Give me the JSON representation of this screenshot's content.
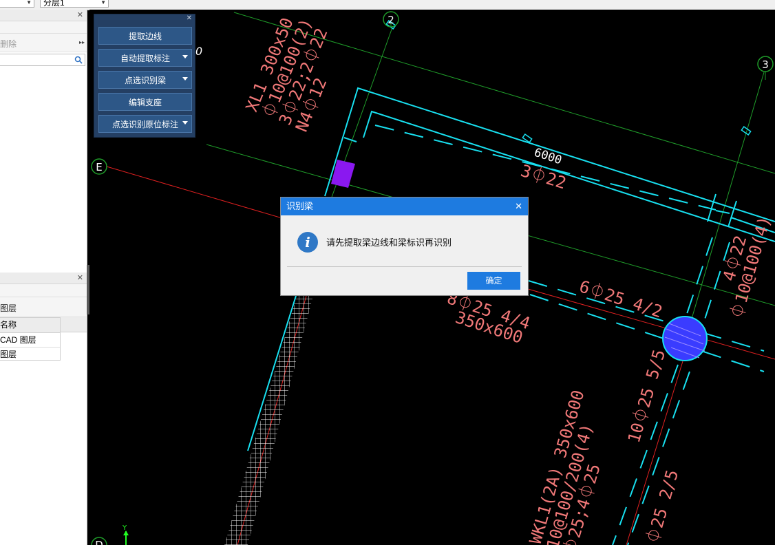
{
  "topbar": {
    "combo_left_value": "",
    "floor_combo_value": "分层1"
  },
  "left_panel": {
    "top_panel": {
      "toolbar_item": "删除",
      "more": "▸▸"
    },
    "layer_panel": {
      "title": "图层",
      "column_header": "名称",
      "rows": [
        "CAD 图层",
        "图层"
      ]
    }
  },
  "toolbar": {
    "buttons": [
      {
        "label": "提取边线",
        "dropdown": false
      },
      {
        "label": "自动提取标注",
        "dropdown": true
      },
      {
        "label": "点选识别梁",
        "dropdown": true
      },
      {
        "label": "编辑支座",
        "dropdown": false
      },
      {
        "label": "点选识别原位标注",
        "dropdown": true
      }
    ]
  },
  "dialog": {
    "title": "识别梁",
    "message": "请先提取梁边线和梁标识再识别",
    "ok_label": "确定"
  },
  "cad": {
    "axis_labels": {
      "a2": "2",
      "a3": "3",
      "e": "E",
      "d": "D"
    },
    "edge_text": "0",
    "xl1": {
      "line1": "XL1 300x50",
      "line2": "⏀10@100(2)",
      "line3": "3⏀22;2⏀22",
      "line4": "N4⏀12"
    },
    "span": {
      "length": "6000",
      "bars": "3⏀22"
    },
    "beam_a": {
      "line1": "6⏀25 4/2"
    },
    "beam_b": {
      "line1": "8⏀25 4/4",
      "line2": "350x600"
    },
    "right_beam": {
      "line1": "4⏀22",
      "line2": "⏀10@100(4)"
    },
    "col_text": {
      "a": "10⏀25 5/5",
      "b": "⏀25 2/5"
    },
    "wkl": {
      "line1": "WKL1(2A) 350x600",
      "line2": "10@100/200(4)",
      "line3": "⏀25;4⏀25"
    },
    "axis_y": "Y"
  },
  "colors": {
    "beam_line": "#18e0f0",
    "annotation": "#f07878",
    "axis_line": "#e02020",
    "grid_line": "#1f9d2a",
    "dialog_accent": "#1e7be0",
    "toolbar_bg": "#243f63",
    "column_fill": "#3a3cff",
    "support_fill": "#8a18f0"
  }
}
